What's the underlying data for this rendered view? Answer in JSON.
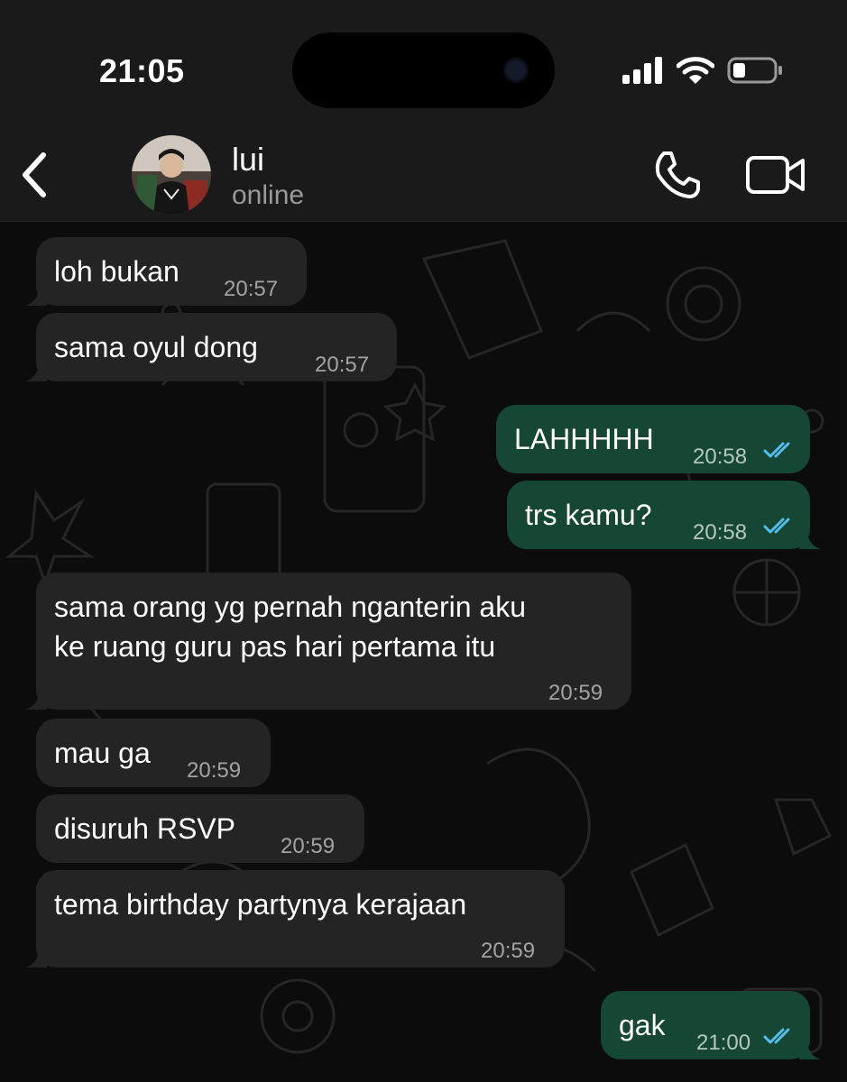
{
  "status_bar": {
    "time": "21:05"
  },
  "header": {
    "back_icon": "chevron-left-icon",
    "contact_name": "lui",
    "contact_status": "online",
    "call_icon": "phone-icon",
    "video_icon": "video-camera-icon"
  },
  "colors": {
    "incoming_bubble": "#242424",
    "outgoing_bubble": "#154734",
    "read_ticks": "#53bdeb",
    "header_bg": "#1a1a1a"
  },
  "messages": [
    {
      "dir": "in",
      "text": "loh bukan",
      "time": "20:57"
    },
    {
      "dir": "in",
      "text": "sama oyul dong",
      "time": "20:57"
    },
    {
      "dir": "out",
      "text": "LAHHHHH",
      "time": "20:58",
      "status": "read"
    },
    {
      "dir": "out",
      "text": "trs kamu?",
      "time": "20:58",
      "status": "read"
    },
    {
      "dir": "in",
      "lines": [
        "sama orang yg pernah nganterin aku",
        "ke ruang guru pas hari pertama itu"
      ],
      "time": "20:59"
    },
    {
      "dir": "in",
      "text": "mau ga",
      "time": "20:59"
    },
    {
      "dir": "in",
      "text": "disuruh RSVP",
      "time": "20:59"
    },
    {
      "dir": "in",
      "text": "tema birthday partynya kerajaan",
      "time": "20:59"
    },
    {
      "dir": "out",
      "text": "gak",
      "time": "21:00",
      "status": "read"
    }
  ]
}
